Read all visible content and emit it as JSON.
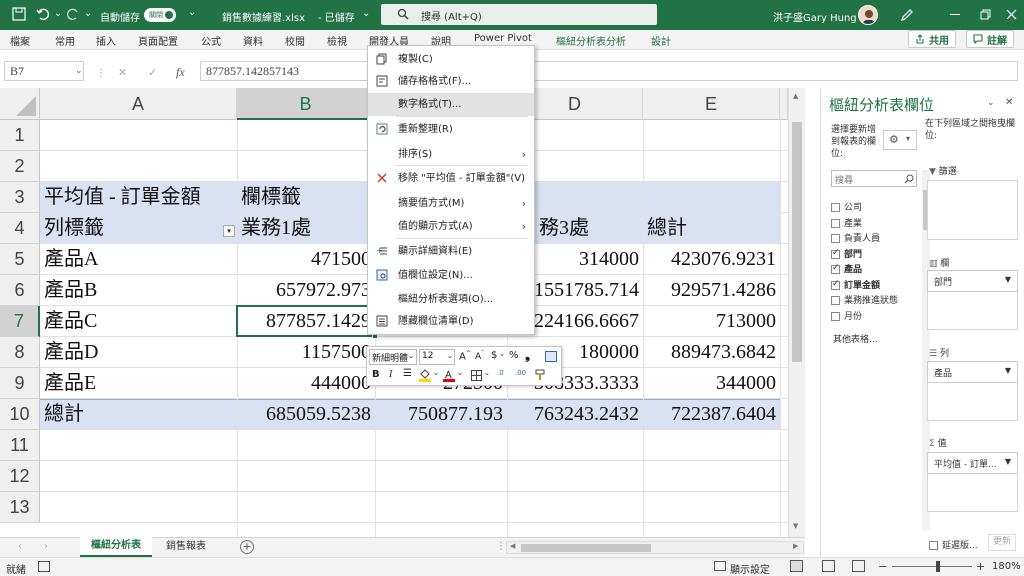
{
  "titlebar": {
    "autosave": "自動儲存",
    "autosave_toggle": "關閉",
    "filename": "銷售數據練習.xlsx",
    "saved": "- 已儲存",
    "search": "搜尋 (Alt+Q)",
    "user": "洪子盛Gary Hung"
  },
  "ribbon": {
    "tabs": [
      "檔案",
      "常用",
      "插入",
      "頁面配置",
      "公式",
      "資料",
      "校閱",
      "檢視",
      "開發人員",
      "說明",
      "Power Pivot",
      "樞紐分析表分析",
      "設計"
    ],
    "share": "共用",
    "comment": "註解"
  },
  "formula": {
    "namebox": "B7",
    "fx": "fx",
    "value": "877857.142857143"
  },
  "grid": {
    "columns": [
      "A",
      "B",
      "C",
      "D",
      "E"
    ],
    "rows": [
      {
        "n": "1",
        "a": "",
        "b": "",
        "d": "",
        "e": ""
      },
      {
        "n": "2",
        "a": "",
        "b": "",
        "d": "",
        "e": ""
      },
      {
        "n": "3",
        "a": "平均值 - 訂單金額",
        "b": "欄標籤",
        "d": "",
        "e": ""
      },
      {
        "n": "4",
        "a": "列標籤",
        "b": "業務1處",
        "d": "務3處",
        "e": "總計"
      },
      {
        "n": "5",
        "a": "產品A",
        "b": "471500",
        "d": "314000",
        "e": "423076.9231"
      },
      {
        "n": "6",
        "a": "產品B",
        "b": "657972.973",
        "d": "1551785.714",
        "e": "929571.4286"
      },
      {
        "n": "7",
        "a": "產品C",
        "b": "877857.1429",
        "d": "224166.6667",
        "e": "713000"
      },
      {
        "n": "8",
        "a": "產品D",
        "b": "1157500",
        "d": "180000",
        "e": "889473.6842"
      },
      {
        "n": "9",
        "a": "產品E",
        "b": "444000",
        "c": "272500",
        "d": "308333.3333",
        "e": "344000"
      },
      {
        "n": "10",
        "a": "總計",
        "b": "685059.5238",
        "c": "750877.193",
        "d": "763243.2432",
        "e": "722387.6404"
      },
      {
        "n": "11",
        "a": "",
        "b": "",
        "d": "",
        "e": ""
      },
      {
        "n": "12",
        "a": "",
        "b": "",
        "d": "",
        "e": ""
      },
      {
        "n": "13",
        "a": "",
        "b": "",
        "d": "",
        "e": ""
      }
    ]
  },
  "context_menu": [
    {
      "label": "複製(C)",
      "icon": "copy-icon"
    },
    {
      "label": "儲存格格式(F)...",
      "icon": "format-cells-icon"
    },
    {
      "label": "數字格式(T)...",
      "icon": ""
    },
    {
      "label": "重新整理(R)",
      "icon": "refresh-icon"
    },
    {
      "label": "排序(S)",
      "icon": "",
      "arrow": "›"
    },
    {
      "label": "移除 \"平均值 - 訂單金額\"(V)",
      "icon": "remove-x-icon"
    },
    {
      "label": "摘要值方式(M)",
      "icon": "",
      "arrow": "›"
    },
    {
      "label": "值的顯示方式(A)",
      "icon": "",
      "arrow": "›"
    },
    {
      "label": "顯示詳細資料(E)",
      "icon": "show-detail-icon"
    },
    {
      "label": "值欄位設定(N)...",
      "icon": "field-settings-icon"
    },
    {
      "label": "樞紐分析表選項(O)...",
      "icon": ""
    },
    {
      "label": "隱藏欄位清單(D)",
      "icon": "field-list-icon"
    }
  ],
  "mini_toolbar": {
    "font": "新細明體",
    "size": "12"
  },
  "sheets": [
    "樞紐分析表",
    "銷售報表"
  ],
  "status": {
    "ready": "就緒",
    "display_settings": "顯示設定",
    "zoom": "180%"
  },
  "pane": {
    "title": "樞紐分析表欄位",
    "choose_label": "選擇要新增到報表的欄位:",
    "drag_label": "在下列區域之間拖曳欄位:",
    "search_placeholder": "搜尋",
    "fields": [
      {
        "name": "公司",
        "checked": false,
        "bold": false
      },
      {
        "name": "產業",
        "checked": false,
        "bold": false
      },
      {
        "name": "負責人員",
        "checked": false,
        "bold": false
      },
      {
        "name": "部門",
        "checked": true,
        "bold": true
      },
      {
        "name": "產品",
        "checked": true,
        "bold": true
      },
      {
        "name": "訂單金額",
        "checked": true,
        "bold": true
      },
      {
        "name": "業務推進狀態",
        "checked": false,
        "bold": false
      },
      {
        "name": "月份",
        "checked": false,
        "bold": false
      }
    ],
    "more_tables": "其他表格...",
    "filters_label": "篩選",
    "columns_label": "欄",
    "columns_value": "部門",
    "rows_label": "列",
    "rows_value": "產品",
    "values_label": "值",
    "values_value": "平均值 - 訂單...",
    "defer": "延遲版...",
    "update": "更新"
  },
  "colors": {
    "excel_green": "#217346",
    "pivot_header": "#d9e1f2",
    "selection": "#217346"
  }
}
